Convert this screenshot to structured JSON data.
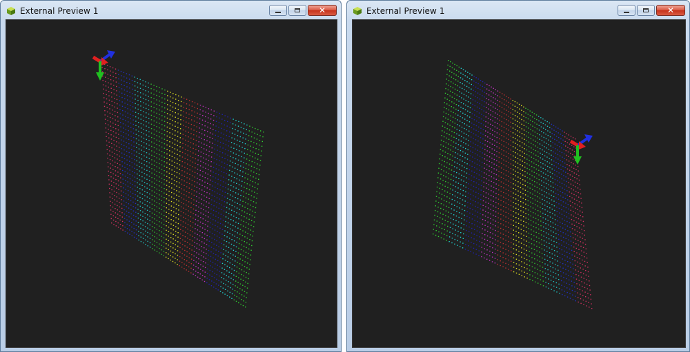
{
  "windows": [
    {
      "title": "External Preview 1"
    },
    {
      "title": "External Preview 1"
    }
  ],
  "controls": {
    "minimize_icon": "minimize-icon",
    "maximize_icon": "maximize-icon",
    "close_glyph": "✕"
  },
  "colors": {
    "viewport_bg": "#202020",
    "stripes": [
      "#d03060",
      "#2030c0",
      "#20c0c0",
      "#30c030",
      "#e0e020",
      "#c03030",
      "#c030c0",
      "#2020b0",
      "#20d0d0",
      "#30d030"
    ],
    "gizmo": {
      "x_axis": "#e02020",
      "y_axis": "#20c020",
      "z_axis": "#2030e0"
    }
  }
}
